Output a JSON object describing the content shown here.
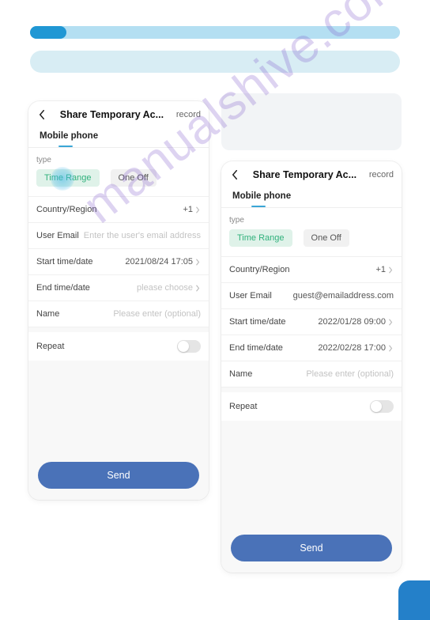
{
  "watermark": "manualshive.com",
  "left": {
    "title": "Share Temporary Ac...",
    "record": "record",
    "tab": "Mobile phone",
    "type_label": "type",
    "chip_active": "Time Range",
    "chip_inactive": "One Off",
    "country_label": "Country/Region",
    "country_value": "+1",
    "email_label": "User Email",
    "email_placeholder": "Enter the user's email address",
    "start_label": "Start time/date",
    "start_value": "2021/08/24 17:05",
    "end_label": "End time/date",
    "end_placeholder": "please choose",
    "name_label": "Name",
    "name_placeholder": "Please enter (optional)",
    "repeat_label": "Repeat",
    "send": "Send"
  },
  "right": {
    "title": "Share Temporary Ac...",
    "record": "record",
    "tab": "Mobile phone",
    "type_label": "type",
    "chip_active": "Time Range",
    "chip_inactive": "One Off",
    "country_label": "Country/Region",
    "country_value": "+1",
    "email_label": "User Email",
    "email_value": "guest@emailaddress.com",
    "start_label": "Start time/date",
    "start_value": "2022/01/28 09:00",
    "end_label": "End time/date",
    "end_value": "2022/02/28 17:00",
    "name_label": "Name",
    "name_placeholder": "Please enter (optional)",
    "repeat_label": "Repeat",
    "send": "Send"
  }
}
